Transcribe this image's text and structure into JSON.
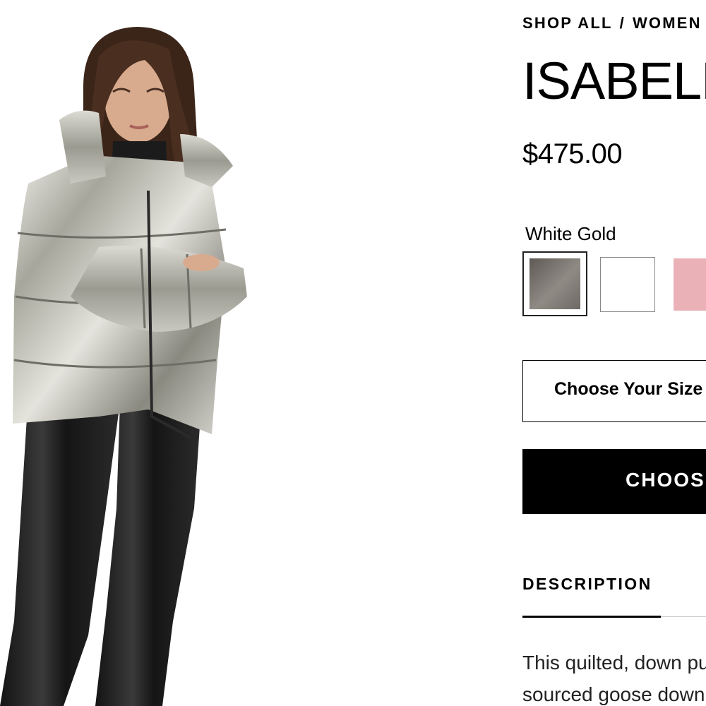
{
  "breadcrumb": {
    "items": [
      "SHOP ALL",
      "WOMEN"
    ],
    "separator": "/"
  },
  "product": {
    "title": "ISABELLA",
    "price": "$475.00",
    "image_alt_icon": "product-photo"
  },
  "color": {
    "selected_name": "White Gold",
    "swatches": [
      {
        "name": "White Gold",
        "hex": "#7d7872",
        "selected": true
      },
      {
        "name": "White",
        "hex": "#ffffff",
        "selected": false
      },
      {
        "name": "Pink",
        "hex": "#eab2b6",
        "selected": false
      }
    ]
  },
  "size_select": {
    "placeholder": "Choose Your Size"
  },
  "cta": {
    "label": "CHOOSE A SIZE"
  },
  "description": {
    "tab_label": "DESCRIPTION",
    "text": "This quilted, down puffer uses responsibly sourced goose down to achieve"
  },
  "colors": {
    "accent": "#000000",
    "background": "#ffffff"
  }
}
